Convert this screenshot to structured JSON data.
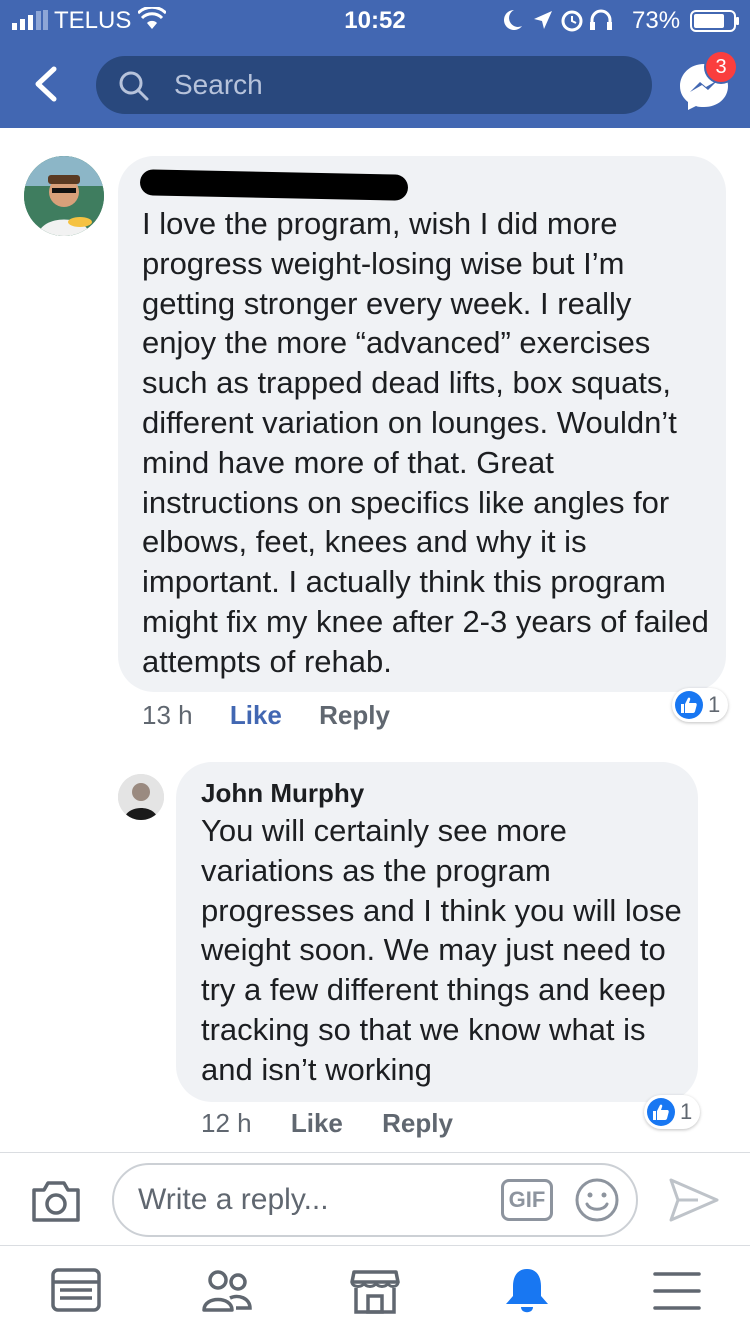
{
  "status_bar": {
    "carrier": "TELUS",
    "time": "10:52",
    "battery_percent": "73%"
  },
  "header": {
    "search_placeholder": "Search",
    "messenger_badge": "3",
    "accent_color": "#4267b2"
  },
  "comments": [
    {
      "author": "",
      "text": "I love the program, wish I did more progress weight-losing wise but I’m getting stronger every week. I really enjoy the more “advanced” exercises such as trapped dead lifts, box squats, different variation on lounges. Wouldn’t mind have more of that. Great instructions on specifics like angles for elbows, feet, knees and why it is important. I actually think this program might fix my knee after 2-3 years of failed attempts of rehab.",
      "age": "13 h",
      "like_label": "Like",
      "reply_label": "Reply",
      "reaction_count": "1"
    },
    {
      "author": "John Murphy",
      "text": "You will certainly see more variations as the program progresses and I think you will lose weight soon. We may just need to try a few different things and keep tracking so that we know what is and isn’t working",
      "age": "12 h",
      "like_label": "Like",
      "reply_label": "Reply",
      "reaction_count": "1"
    }
  ],
  "composer": {
    "placeholder": "Write a reply...",
    "gif_label": "GIF"
  },
  "tabbar": {
    "items": [
      "news-feed",
      "friends",
      "marketplace",
      "notifications",
      "menu"
    ],
    "active": "notifications"
  }
}
